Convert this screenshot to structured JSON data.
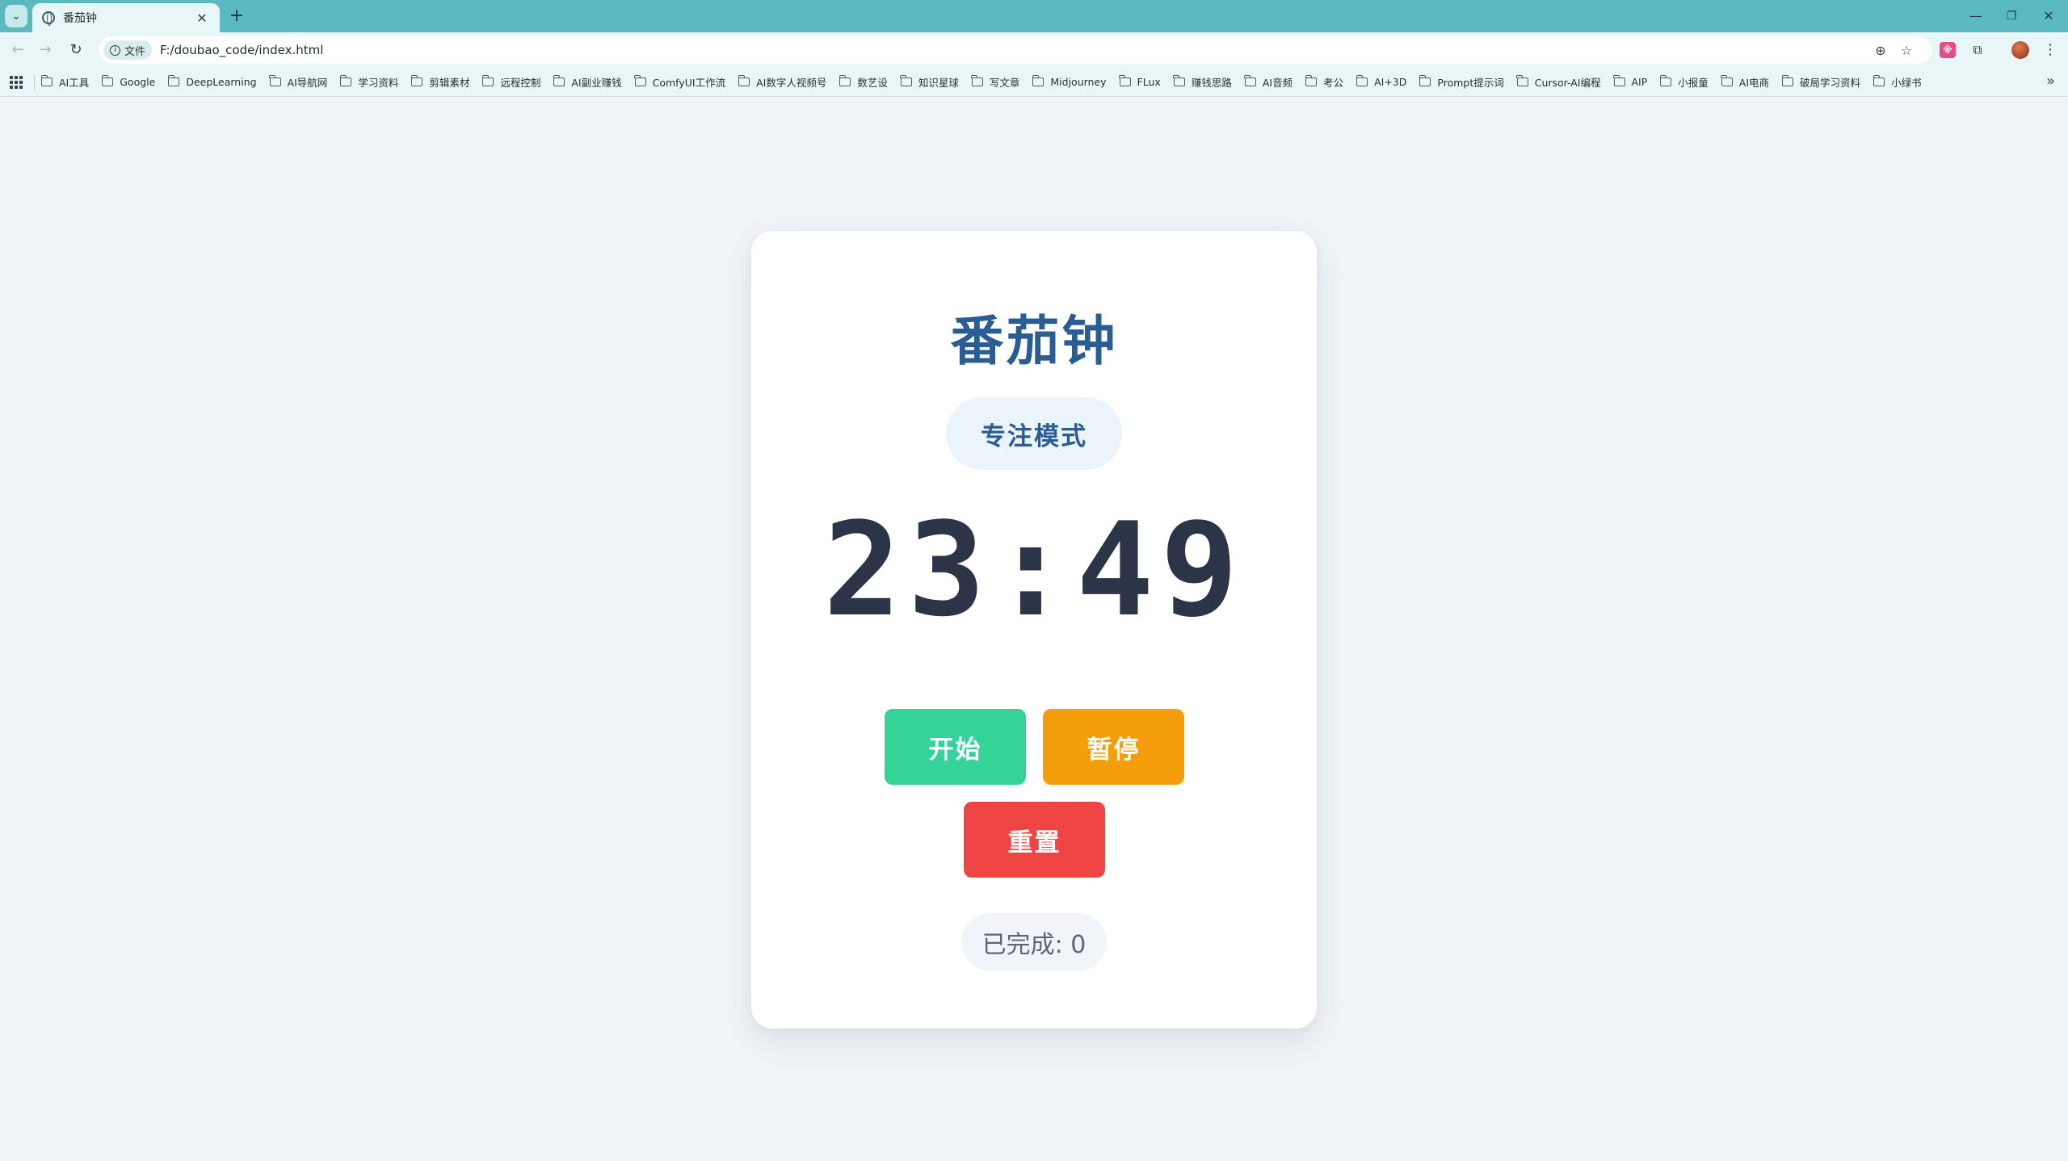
{
  "browser": {
    "tab_title": "番茄钟",
    "tab_close": "✕",
    "new_tab": "+",
    "url_chip": "文件",
    "url": "F:/doubao_code/index.html",
    "window_controls": {
      "minimize": "—",
      "restore": "❐",
      "close": "✕"
    }
  },
  "bookmarks": [
    "AI工具",
    "Google",
    "DeepLearning",
    "AI导航网",
    "学习资料",
    "剪辑素材",
    "远程控制",
    "AI副业赚钱",
    "ComfyUI工作流",
    "AI数字人视频号",
    "数艺设",
    "知识星球",
    "写文章",
    "Midjourney",
    "FLux",
    "赚钱思路",
    "AI音频",
    "考公",
    "AI+3D",
    "Prompt提示词",
    "Cursor-AI编程",
    "AIP",
    "小报童",
    "AI电商",
    "破局学习资料",
    "小绿书"
  ],
  "app": {
    "title": "番茄钟",
    "mode": "专注模式",
    "timer": "23:49",
    "buttons": {
      "start": "开始",
      "pause": "暂停",
      "reset": "重置"
    },
    "completed_label": "已完成: 0"
  },
  "colors": {
    "title": "#2b5d95",
    "start": "#34d399",
    "pause": "#f59e0b",
    "reset": "#ef4444",
    "timer": "#2c3547"
  }
}
